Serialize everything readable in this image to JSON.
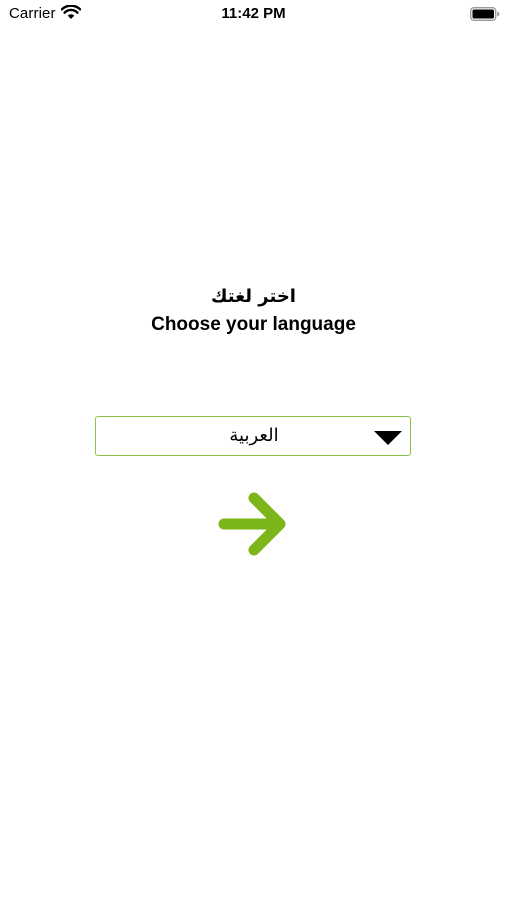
{
  "status_bar": {
    "carrier": "Carrier",
    "time": "11:42 PM",
    "icons": [
      "wifi-icon",
      "battery-icon"
    ]
  },
  "language_screen": {
    "title_ar": "اختر لغتك",
    "title_en": "Choose your language",
    "selected_language": "العربية",
    "dropdown_icon": "caret-down-icon",
    "next_icon": "arrow-right-icon"
  },
  "colors": {
    "accent": "#7cb518",
    "border": "#8bc34a",
    "text": "#000000",
    "background": "#ffffff"
  }
}
